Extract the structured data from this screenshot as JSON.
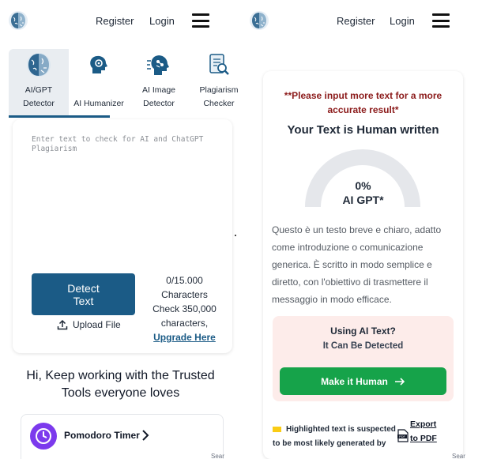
{
  "header": {
    "register_label": "Register",
    "login_label": "Login"
  },
  "tabs": [
    {
      "label_line1": "AI/GPT",
      "label_line2": "Detector",
      "active": true,
      "icon": "brain-icon"
    },
    {
      "label_line1": "",
      "label_line2": "AI Humanizer",
      "active": false,
      "icon": "head-gear-icon"
    },
    {
      "label_line1": "AI Image",
      "label_line2": "Detector",
      "active": false,
      "icon": "ai-head-icon"
    },
    {
      "label_line1": "Plagiarism",
      "label_line2": "Checker",
      "active": false,
      "icon": "document-search-icon"
    }
  ],
  "detector": {
    "input_placeholder": "Enter text to check for AI and ChatGPT Plagiarism",
    "input_value": "",
    "detect_line1": "Detect",
    "detect_line2": "Text",
    "upload_label": "Upload File",
    "char_count": "0/15.000",
    "char_unit": "Characters",
    "check_line1": "Check 350,000",
    "check_line2": "characters,",
    "upgrade_label": "Upgrade Here"
  },
  "promo": {
    "heading_line1": "Hi, Keep working with the Trusted",
    "heading_line2": "Tools everyone loves",
    "tool_label": "Pomodoro Timer",
    "ad_label": "Sear"
  },
  "result": {
    "warning_line1": "**Please input more text for a more",
    "warning_line2": "accurate result*",
    "title": "Your Text is Human written",
    "gauge_percent": "0%",
    "gauge_fraction": 0,
    "gauge_label": "AI GPT*",
    "sample_lines": [
      "Questo è un testo breve e chiaro, adatto",
      "come introduzione o comunicazione",
      "generica. È scritto in modo semplice e",
      "diretto, con l'obiettivo di trasmettere il",
      "messaggio in modo efficace."
    ],
    "ai_question": "Using AI Text?",
    "ai_subtitle": "It Can Be Detected",
    "human_button_label": "Make it Human",
    "legend_line1": "Highlighted text is suspected",
    "legend_line2": "to be most likely generated by",
    "export_line1": "Export",
    "export_line2": "to PDF",
    "ad_label": "Sear"
  },
  "colors": {
    "primary": "#1b5b86",
    "warning": "#8b1a1a",
    "success": "#16a34a",
    "ai_box_bg": "#fdecea",
    "highlight": "#facc15",
    "gauge_track": "#e5e7eb"
  }
}
